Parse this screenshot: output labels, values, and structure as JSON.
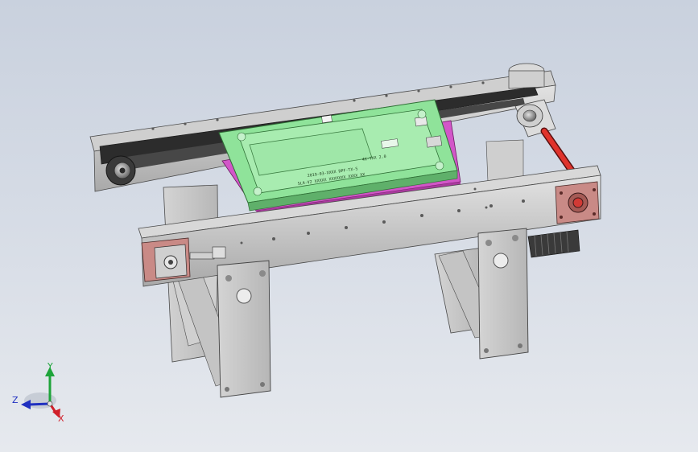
{
  "viewport": {
    "background_top": "#c9d1de",
    "background_bottom": "#e6e9ee"
  },
  "model": {
    "frame_color": "#c8c8c8",
    "frame_edge_color": "#505050",
    "belt_color": "#2c2c2c",
    "pcb_color": "#8fe39a",
    "pcb_edge_color": "#2f6f36",
    "pallet_color": "#d256c8",
    "end_plate_color": "#c98a86",
    "rod_color": "#e0332c",
    "pcb_label_1": "4X-TXX  2.0",
    "pcb_label_2": "2019-03-XXXX  DPF-TX-S",
    "pcb_label_3": "SLA-V2  XXXXX  XXXXXXX  XXXX  XX"
  },
  "triad": {
    "x_label": "X",
    "y_label": "Y",
    "z_label": "Z",
    "x_color": "#d0202a",
    "y_color": "#1ea43a",
    "z_color": "#2030c0"
  }
}
